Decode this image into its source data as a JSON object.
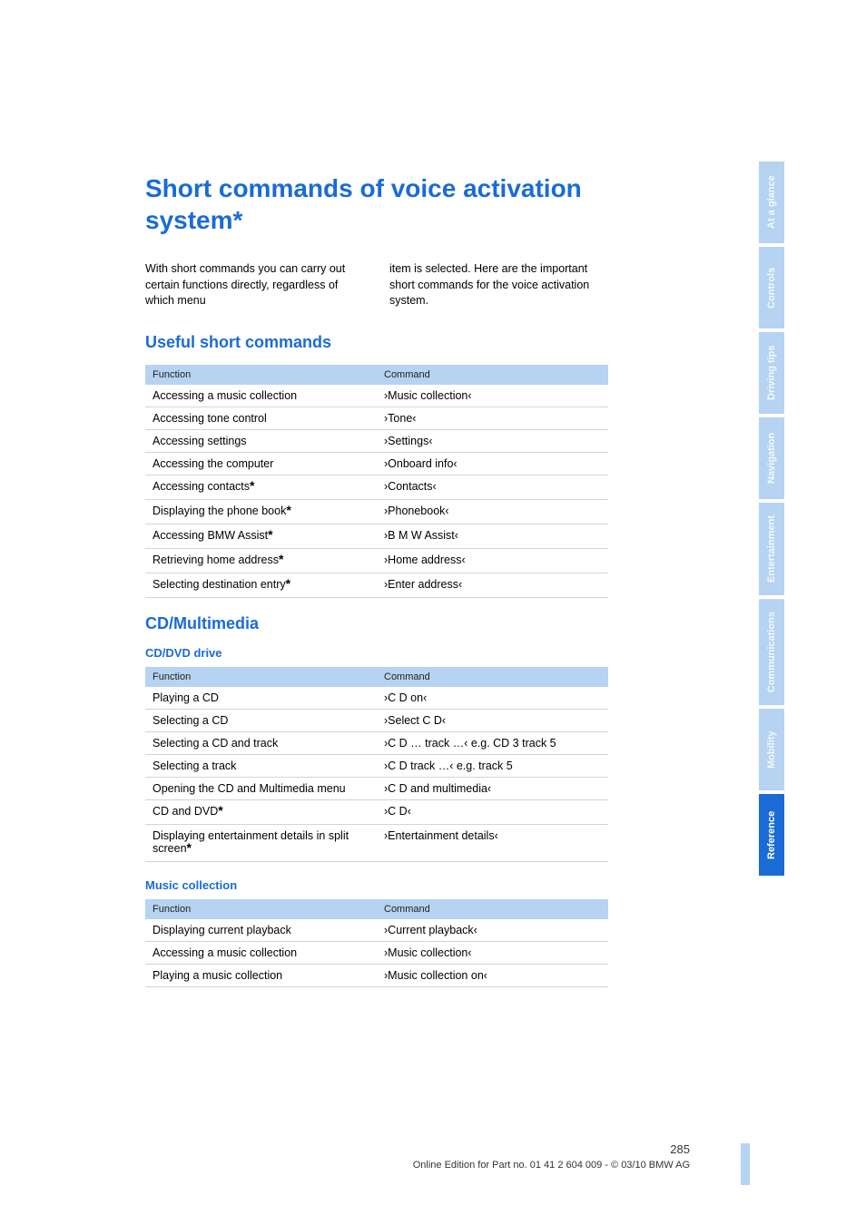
{
  "title": "Short commands of voice activation system*",
  "intro_left": "With short commands you can carry out certain functions directly, regardless of which menu",
  "intro_right": "item is selected. Here are the important short commands for the voice activation system.",
  "section1_heading": "Useful short commands",
  "headers": {
    "func": "Function",
    "cmd": "Command"
  },
  "table1": [
    {
      "func": "Accessing a music collection",
      "star": false,
      "cmd": "›Music collection‹"
    },
    {
      "func": "Accessing tone control",
      "star": false,
      "cmd": "›Tone‹"
    },
    {
      "func": "Accessing settings",
      "star": false,
      "cmd": "›Settings‹"
    },
    {
      "func": "Accessing the computer",
      "star": false,
      "cmd": "›Onboard info‹"
    },
    {
      "func": "Accessing contacts",
      "star": true,
      "cmd": "›Contacts‹"
    },
    {
      "func": "Displaying the phone book",
      "star": true,
      "cmd": "›Phonebook‹"
    },
    {
      "func": "Accessing BMW Assist",
      "star": true,
      "cmd": "›B M W Assist‹"
    },
    {
      "func": "Retrieving home address",
      "star": true,
      "cmd": "›Home address‹"
    },
    {
      "func": "Selecting destination entry",
      "star": true,
      "cmd": "›Enter address‹"
    }
  ],
  "section2_heading": "CD/Multimedia",
  "sub_cd": "CD/DVD drive",
  "table2": [
    {
      "func": "Playing a CD",
      "star": false,
      "cmd": "›C D on‹"
    },
    {
      "func": "Selecting a CD",
      "star": false,
      "cmd": "›Select C D‹"
    },
    {
      "func": "Selecting a CD and track",
      "star": false,
      "cmd": "›C D … track …‹ e.g. CD 3 track 5"
    },
    {
      "func": "Selecting a track",
      "star": false,
      "cmd": "›C D track …‹ e.g. track 5"
    },
    {
      "func": "Opening the CD and Multimedia menu",
      "star": false,
      "cmd": "›C D and multimedia‹"
    },
    {
      "func": "CD and DVD",
      "star": true,
      "cmd": "›C D‹"
    },
    {
      "func": "Displaying entertainment details in split screen",
      "star": true,
      "cmd": "›Entertainment details‹"
    }
  ],
  "sub_music": "Music collection",
  "table3": [
    {
      "func": "Displaying current playback",
      "star": false,
      "cmd": "›Current playback‹"
    },
    {
      "func": "Accessing a music collection",
      "star": false,
      "cmd": "›Music collection‹"
    },
    {
      "func": "Playing a music collection",
      "star": false,
      "cmd": "›Music collection on‹"
    }
  ],
  "footer": {
    "page": "285",
    "line": "Online Edition for Part no. 01 41 2 604 009 - © 03/10 BMW AG"
  },
  "tabs": [
    {
      "label": "At a glance",
      "active": false
    },
    {
      "label": "Controls",
      "active": false
    },
    {
      "label": "Driving tips",
      "active": false
    },
    {
      "label": "Navigation",
      "active": false
    },
    {
      "label": "Entertainment",
      "active": false
    },
    {
      "label": "Communications",
      "active": false
    },
    {
      "label": "Mobility",
      "active": false
    },
    {
      "label": "Reference",
      "active": true
    }
  ]
}
